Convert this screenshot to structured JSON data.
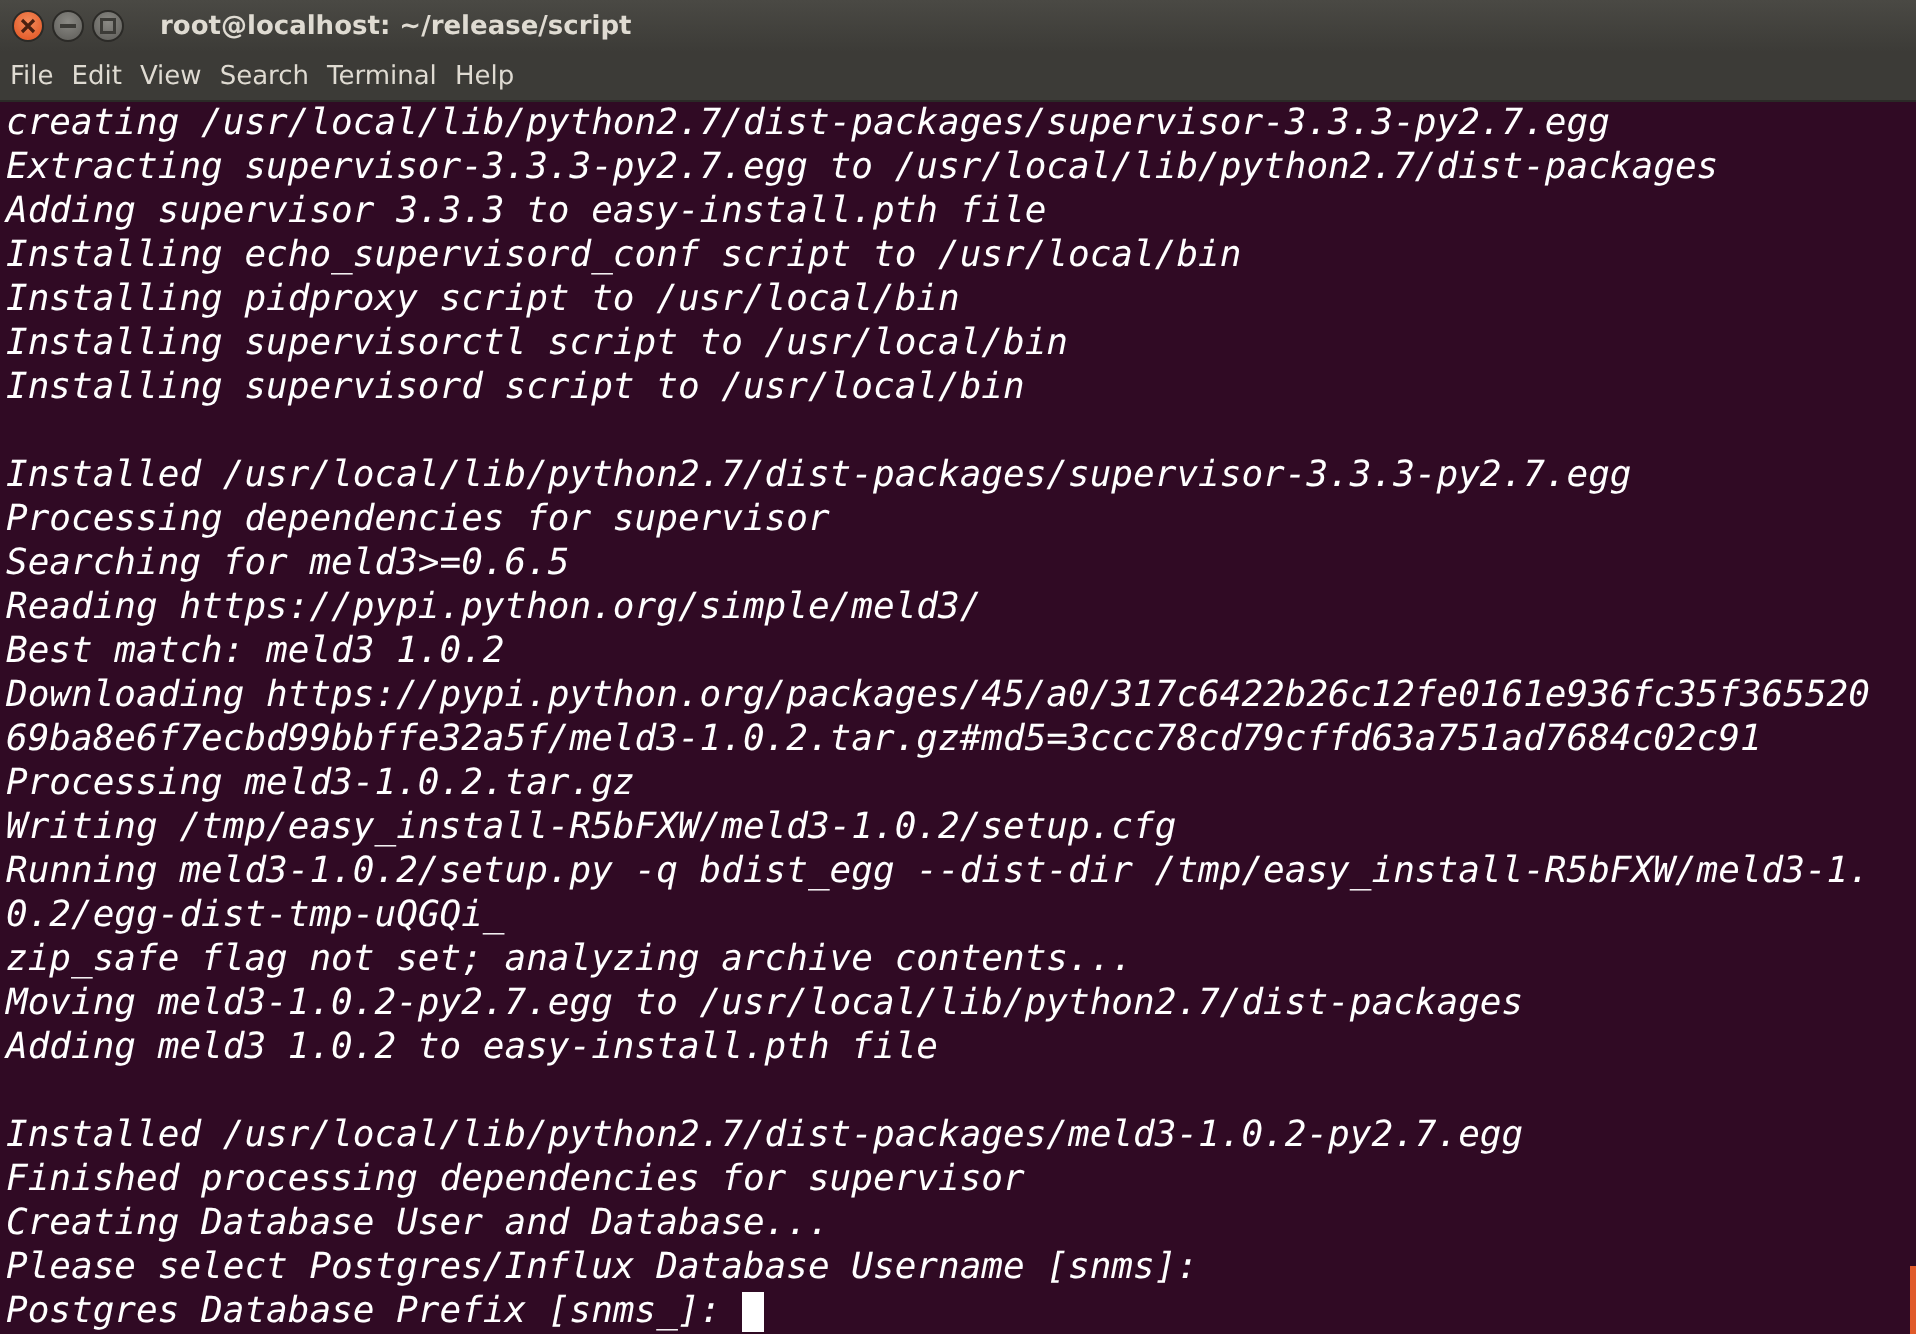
{
  "window": {
    "title": "root@localhost: ~/release/script"
  },
  "menu": [
    "File",
    "Edit",
    "View",
    "Search",
    "Terminal",
    "Help"
  ],
  "terminal": {
    "blocks": [
      [
        "creating /usr/local/lib/python2.7/dist-packages/supervisor-3.3.3-py2.7.egg",
        "Extracting supervisor-3.3.3-py2.7.egg to /usr/local/lib/python2.7/dist-packages",
        "Adding supervisor 3.3.3 to easy-install.pth file",
        "Installing echo_supervisord_conf script to /usr/local/bin",
        "Installing pidproxy script to /usr/local/bin",
        "Installing supervisorctl script to /usr/local/bin",
        "Installing supervisord script to /usr/local/bin"
      ],
      [
        "Installed /usr/local/lib/python2.7/dist-packages/supervisor-3.3.3-py2.7.egg",
        "Processing dependencies for supervisor",
        "Searching for meld3>=0.6.5",
        "Reading https://pypi.python.org/simple/meld3/",
        "Best match: meld3 1.0.2",
        "Downloading https://pypi.python.org/packages/45/a0/317c6422b26c12fe0161e936fc35f365520",
        "69ba8e6f7ecbd99bbffe32a5f/meld3-1.0.2.tar.gz#md5=3ccc78cd79cffd63a751ad7684c02c91",
        "Processing meld3-1.0.2.tar.gz",
        "Writing /tmp/easy_install-R5bFXW/meld3-1.0.2/setup.cfg",
        "Running meld3-1.0.2/setup.py -q bdist_egg --dist-dir /tmp/easy_install-R5bFXW/meld3-1.",
        "0.2/egg-dist-tmp-uQGQi_",
        "zip_safe flag not set; analyzing archive contents...",
        "Moving meld3-1.0.2-py2.7.egg to /usr/local/lib/python2.7/dist-packages",
        "Adding meld3 1.0.2 to easy-install.pth file"
      ],
      [
        "Installed /usr/local/lib/python2.7/dist-packages/meld3-1.0.2-py2.7.egg",
        "Finished processing dependencies for supervisor",
        "Creating Database User and Database...",
        "Please select Postgres/Influx Database Username [snms]:"
      ]
    ],
    "prompt": "Postgres Database Prefix [snms_]: "
  }
}
